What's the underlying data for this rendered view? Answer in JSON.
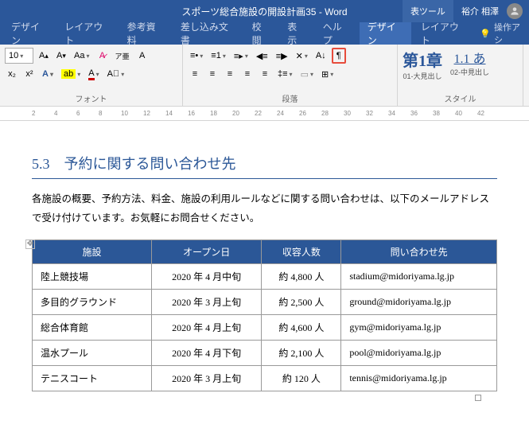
{
  "titlebar": {
    "doc_title": "スポーツ総合施設の開設計画35  -  Word",
    "context_tool": "表ツール",
    "user_name": "裕介 相澤"
  },
  "tabs": {
    "items": [
      "デザイン",
      "レイアウト",
      "参考資料",
      "差し込み文書",
      "校閲",
      "表示",
      "ヘルプ",
      "デザイン",
      "レイアウト"
    ],
    "tell_me": "操作アシ"
  },
  "ribbon": {
    "font": {
      "size": "10",
      "label": "フォント"
    },
    "para": {
      "label": "段落"
    },
    "styles": {
      "label": "スタイル",
      "s1_preview": "第1章",
      "s1_name": "01-大見出し",
      "s2_preview": "1.1  あ",
      "s2_name": "02-中見出し"
    }
  },
  "ruler_marks": [
    "2",
    "4",
    "6",
    "8",
    "10",
    "12",
    "14",
    "16",
    "18",
    "20",
    "22",
    "24",
    "26",
    "28",
    "30",
    "32",
    "34",
    "36",
    "38",
    "40",
    "42"
  ],
  "document": {
    "heading": "5.3　予約に関する問い合わせ先",
    "body": "各施設の概要、予約方法、料金、施設の利用ルールなどに関する問い合わせは、以下のメールアドレスで受け付けています。お気軽にお問合せください。",
    "table": {
      "headers": [
        "施設",
        "オープン日",
        "収容人数",
        "問い合わせ先"
      ],
      "rows": [
        {
          "name": "陸上競技場",
          "open": "2020 年 4 月中旬",
          "cap": "約 4,800 人",
          "contact": "stadium@midoriyama.lg.jp"
        },
        {
          "name": "多目的グラウンド",
          "open": "2020 年 3 月上旬",
          "cap": "約 2,500 人",
          "contact": "ground@midoriyama.lg.jp"
        },
        {
          "name": "総合体育館",
          "open": "2020 年 4 月上旬",
          "cap": "約 4,600 人",
          "contact": "gym@midoriyama.lg.jp"
        },
        {
          "name": "温水プール",
          "open": "2020 年 4 月下旬",
          "cap": "約 2,100 人",
          "contact": "pool@midoriyama.lg.jp"
        },
        {
          "name": "テニスコート",
          "open": "2020 年 3 月上旬",
          "cap": "約 120 人",
          "contact": "tennis@midoriyama.lg.jp"
        }
      ]
    }
  }
}
